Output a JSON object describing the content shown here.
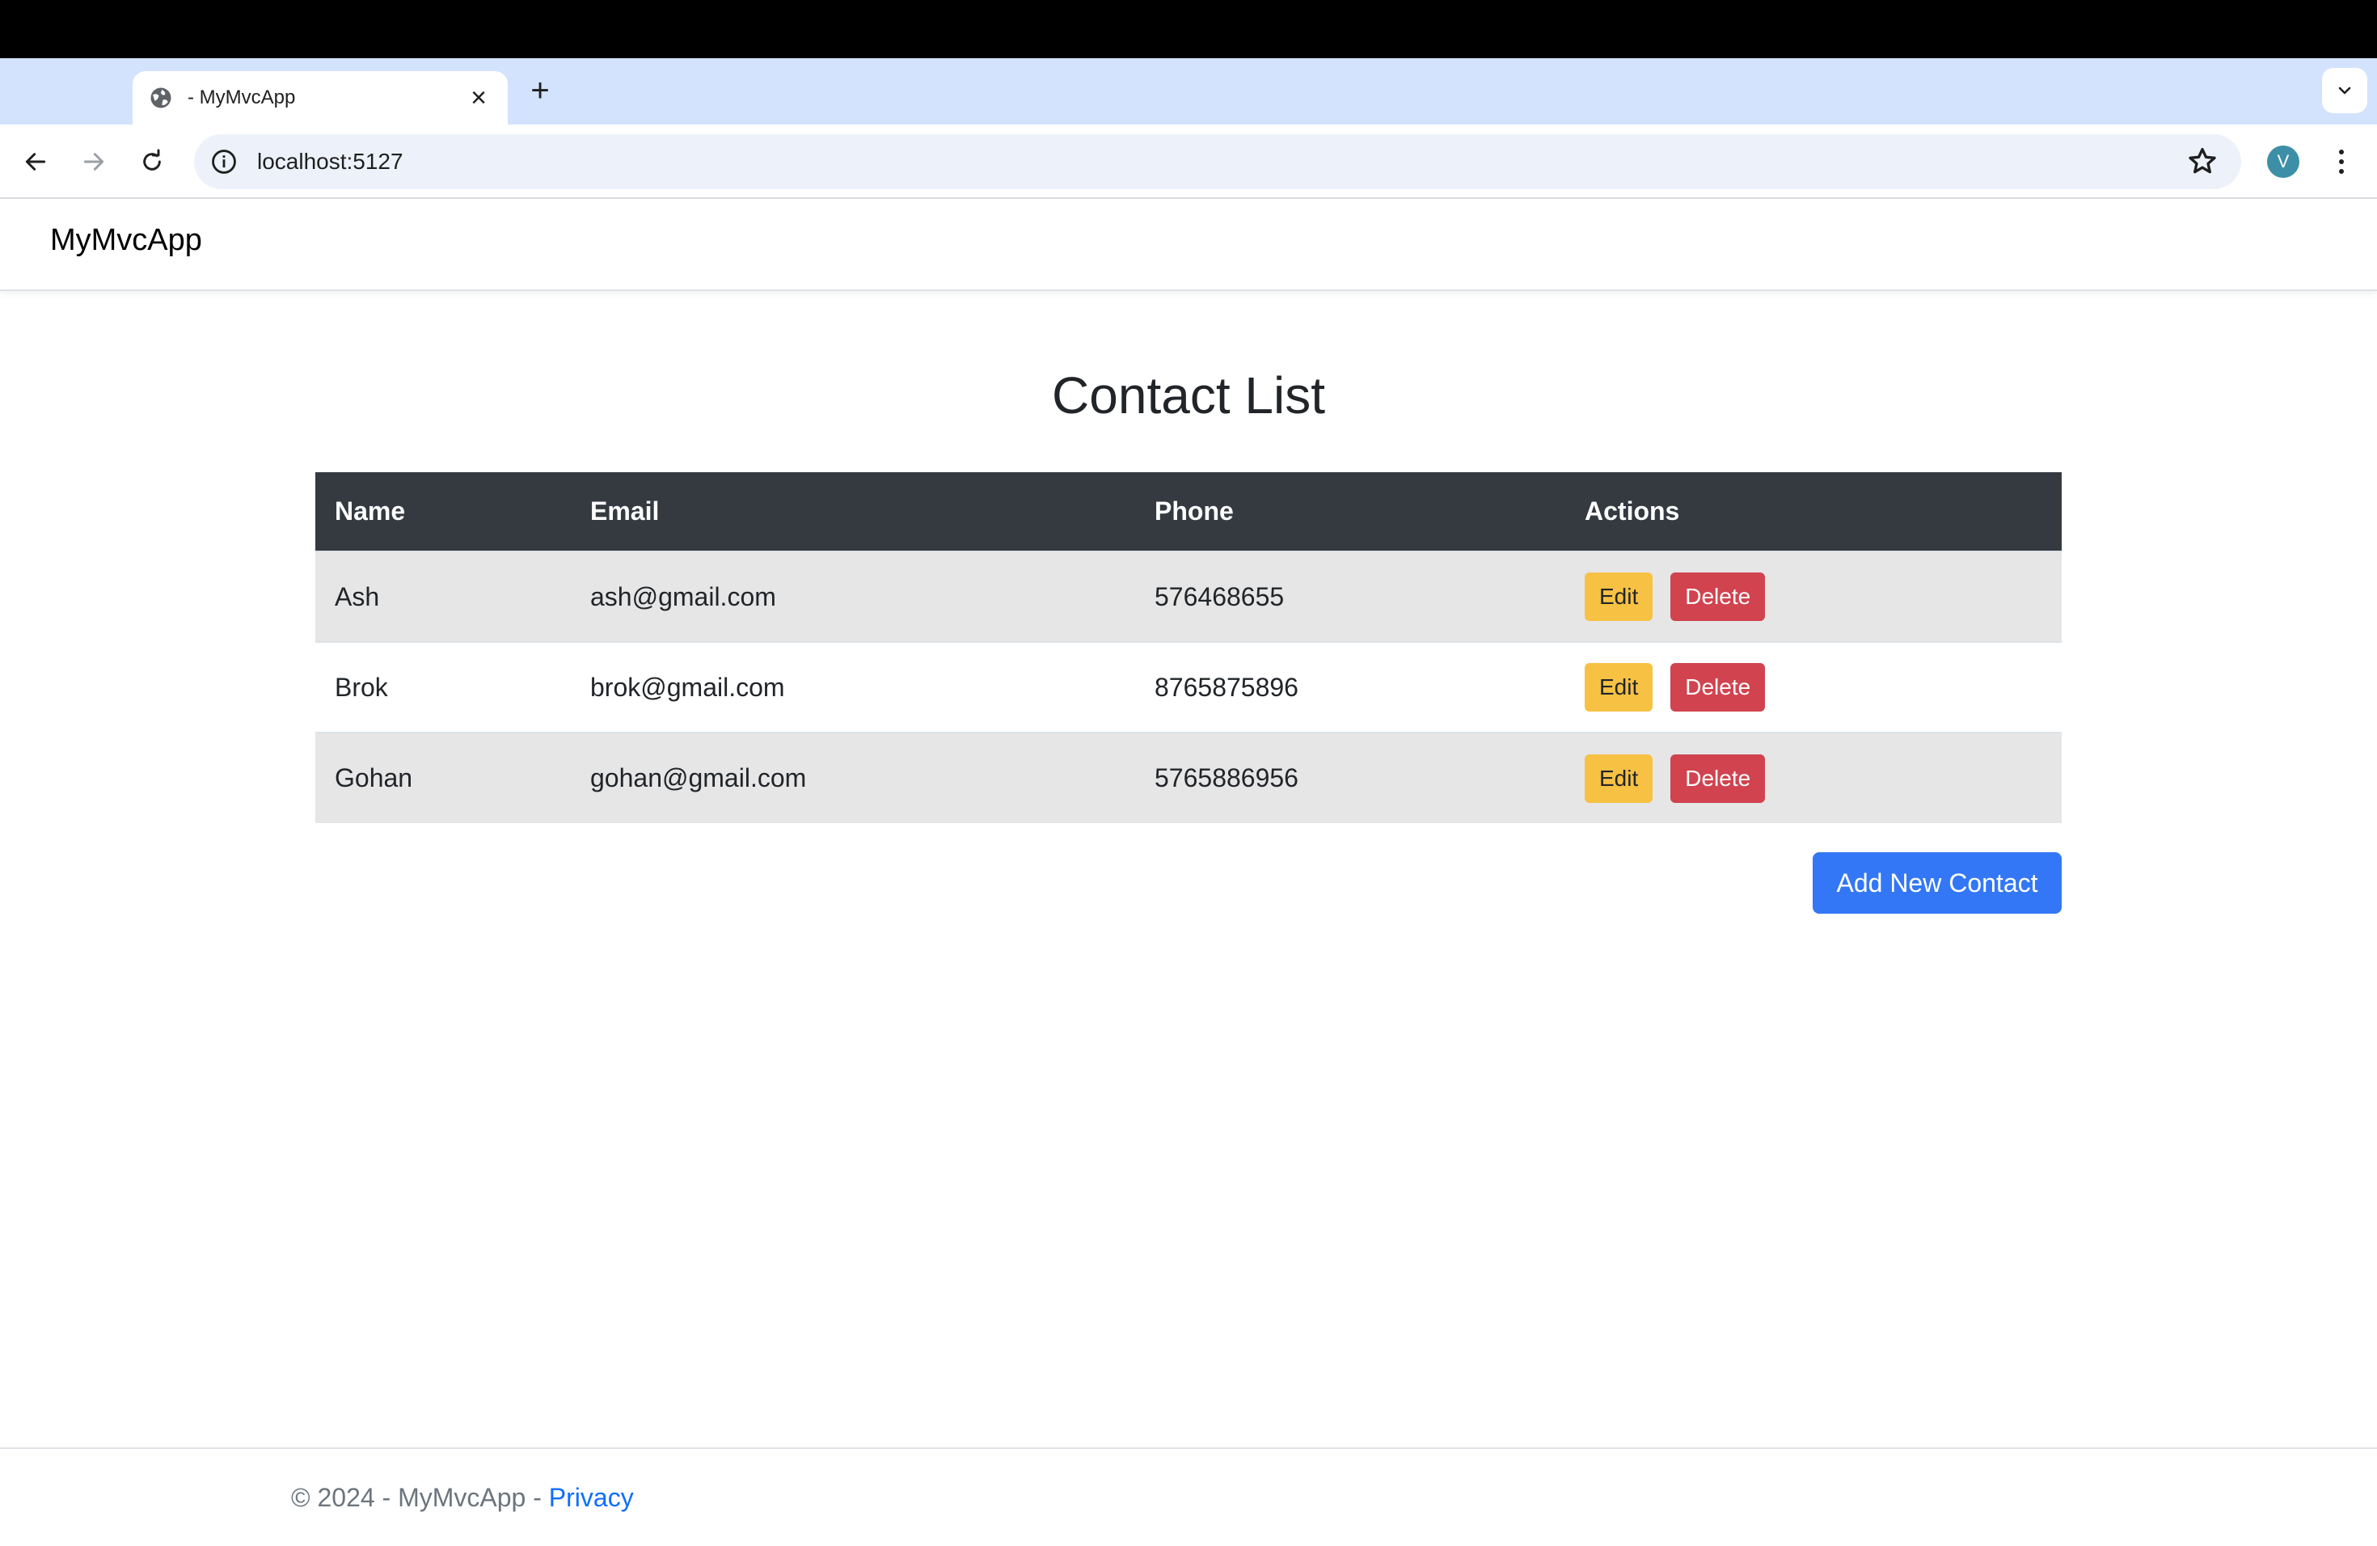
{
  "browser": {
    "tab_title": "- MyMvcApp",
    "url": "localhost:5127",
    "profile_initial": "V"
  },
  "header": {
    "brand": "MyMvcApp"
  },
  "main": {
    "title": "Contact List",
    "columns": {
      "name": "Name",
      "email": "Email",
      "phone": "Phone",
      "actions": "Actions"
    },
    "contacts": [
      {
        "name": "Ash",
        "email": "ash@gmail.com",
        "phone": "576468655"
      },
      {
        "name": "Brok",
        "email": "brok@gmail.com",
        "phone": "8765875896"
      },
      {
        "name": "Gohan",
        "email": "gohan@gmail.com",
        "phone": "5765886956"
      }
    ],
    "edit_label": "Edit",
    "delete_label": "Delete",
    "add_button": "Add New Contact"
  },
  "footer": {
    "copyright": "© 2024 - MyMvcApp - ",
    "privacy_link": "Privacy"
  },
  "colors": {
    "table_header": "#343a40",
    "edit_button": "#f7c143",
    "delete_button": "#d1434f",
    "primary_button": "#3377f6",
    "link": "#0d6efd"
  }
}
